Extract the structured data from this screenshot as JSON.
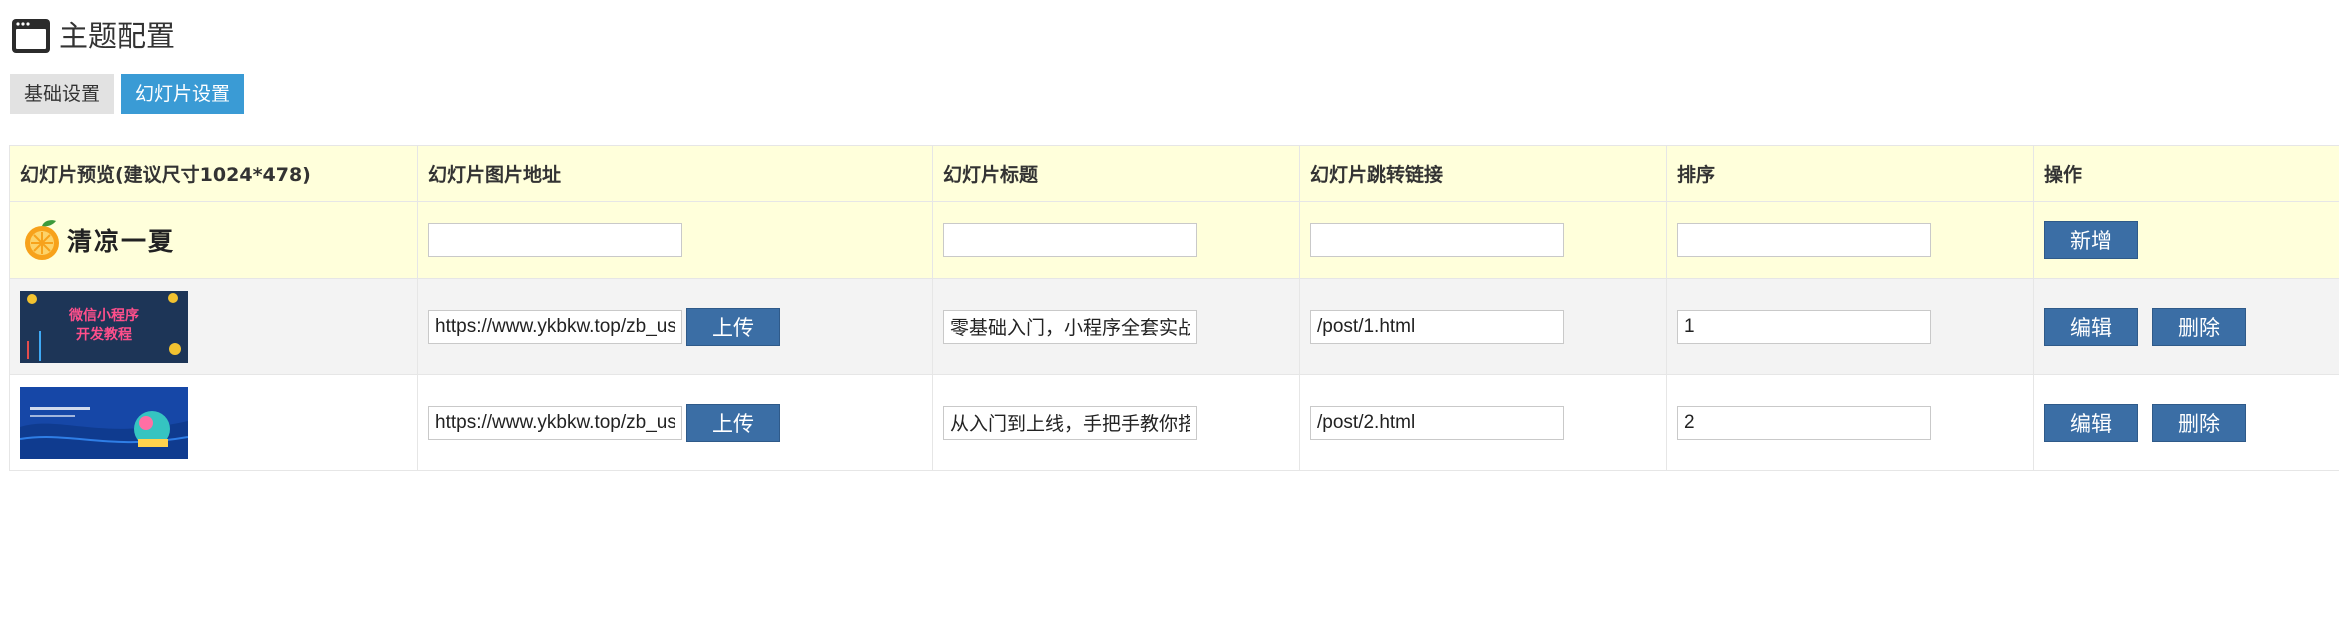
{
  "page": {
    "title": "主题配置",
    "icon": "window-icon"
  },
  "tabs": [
    {
      "label": "基础设置",
      "active": false
    },
    {
      "label": "幻灯片设置",
      "active": true
    }
  ],
  "table": {
    "headers": [
      "幻灯片预览(建议尺寸1024*478)",
      "幻灯片图片地址",
      "幻灯片标题",
      "幻灯片跳转链接",
      "排序",
      "操作"
    ],
    "new_row": {
      "preview_logo": "清凉一夏",
      "image_url": "",
      "title": "",
      "link": "",
      "order": "",
      "add_label": "新增"
    },
    "rows": [
      {
        "preview_text": [
          "微信小程序",
          "开发教程"
        ],
        "image_url": "https://www.ykbkw.top/zb_users/upload/",
        "upload_label": "上传",
        "title": "零基础入门，小程序全套实战",
        "link": "/post/1.html",
        "order": "1",
        "edit_label": "编辑",
        "delete_label": "删除"
      },
      {
        "preview_text": [],
        "image_url": "https://www.ykbkw.top/zb_users/upload/",
        "upload_label": "上传",
        "title": "从入门到上线，手把手教你搭建",
        "link": "/post/2.html",
        "order": "2",
        "edit_label": "编辑",
        "delete_label": "删除"
      }
    ]
  },
  "colors": {
    "active_tab": "#3a9bd5",
    "button": "#3b6ea5",
    "header_bg": "#ffffdb"
  }
}
